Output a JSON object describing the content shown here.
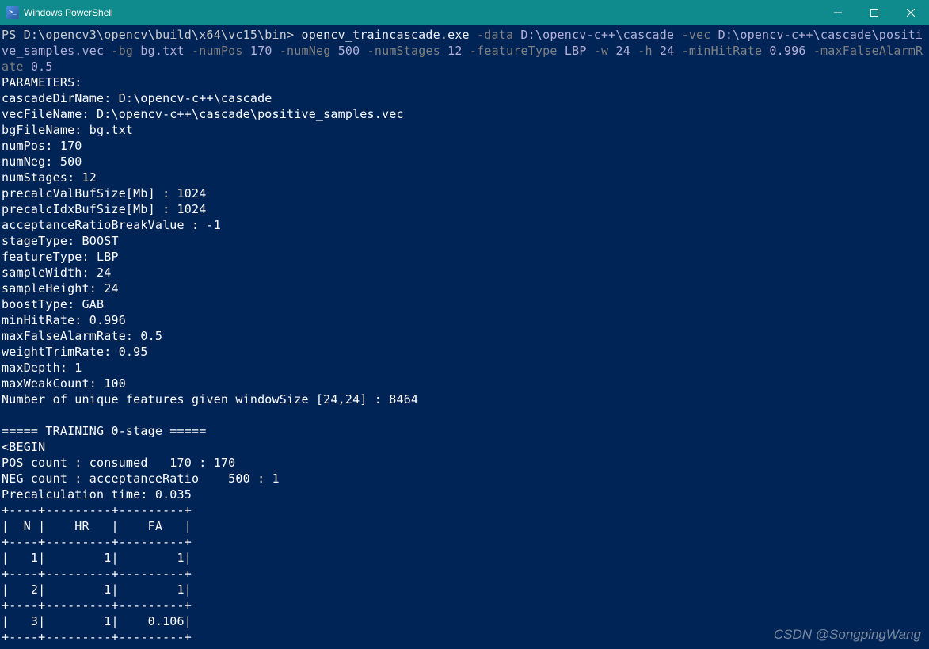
{
  "window": {
    "title": "Windows PowerShell",
    "icon_label": ">_"
  },
  "prompt": {
    "path": "PS D:\\opencv3\\opencv\\build\\x64\\vc15\\bin>",
    "command": "opencv_traincascade.exe",
    "args": {
      "data_flag": "-data",
      "data_val": "D:\\opencv-c++\\cascade",
      "vec_flag": "-vec",
      "vec_val": "D:\\opencv-c++\\cascade\\positive_samples.vec",
      "bg_flag": "-bg",
      "bg_val": "bg.txt",
      "numPos_flag": "-numPos",
      "numPos_val": "170",
      "numNeg_flag": "-numNeg",
      "numNeg_val": "500",
      "numStages_flag": "-numStages",
      "numStages_val": "12",
      "featureType_flag": "-featureType",
      "featureType_val": "LBP",
      "w_flag": "-w",
      "w_val": "24",
      "h_flag": "-h",
      "h_val": "24",
      "minHitRate_flag": "-minHitRate",
      "minHitRate_val": "0.996",
      "maxFalseAlarmRate_flag": "-maxFalseAlarmRate",
      "maxFalseAlarmRate_val": "0.5"
    }
  },
  "output": {
    "params_header": "PARAMETERS:",
    "cascadeDirName": "cascadeDirName: D:\\opencv-c++\\cascade",
    "vecFileName": "vecFileName: D:\\opencv-c++\\cascade\\positive_samples.vec",
    "bgFileName": "bgFileName: bg.txt",
    "numPos": "numPos: 170",
    "numNeg": "numNeg: 500",
    "numStages": "numStages: 12",
    "precalcValBufSize": "precalcValBufSize[Mb] : 1024",
    "precalcIdxBufSize": "precalcIdxBufSize[Mb] : 1024",
    "acceptanceRatioBreakValue": "acceptanceRatioBreakValue : -1",
    "stageType": "stageType: BOOST",
    "featureType": "featureType: LBP",
    "sampleWidth": "sampleWidth: 24",
    "sampleHeight": "sampleHeight: 24",
    "boostType": "boostType: GAB",
    "minHitRate": "minHitRate: 0.996",
    "maxFalseAlarmRate": "maxFalseAlarmRate: 0.5",
    "weightTrimRate": "weightTrimRate: 0.95",
    "maxDepth": "maxDepth: 1",
    "maxWeakCount": "maxWeakCount: 100",
    "uniqueFeatures": "Number of unique features given windowSize [24,24] : 8464",
    "blank": "",
    "training_header": "===== TRAINING 0-stage =====",
    "begin": "<BEGIN",
    "pos_count": "POS count : consumed   170 : 170",
    "neg_count": "NEG count : acceptanceRatio    500 : 1",
    "precalc_time": "Precalculation time: 0.035",
    "table_sep": "+----+---------+---------+",
    "table_header": "|  N |    HR   |    FA   |",
    "table_row1": "|   1|        1|        1|",
    "table_row2": "|   2|        1|        1|",
    "table_row3": "|   3|        1|    0.106|"
  },
  "watermark": "CSDN @SongpingWang"
}
